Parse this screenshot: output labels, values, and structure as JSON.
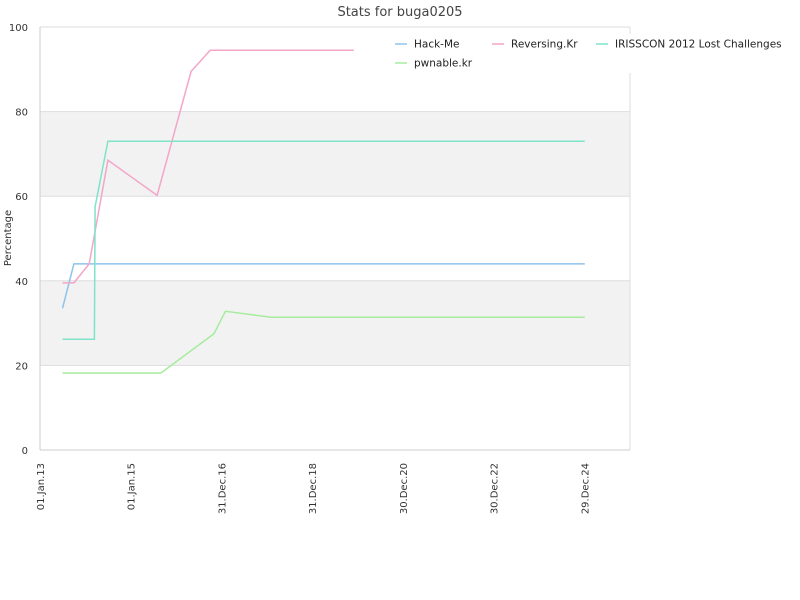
{
  "chart_data": {
    "type": "line",
    "title": "Stats for buga0205",
    "ylabel": "Percentage",
    "xlabel": "",
    "ylim": [
      0,
      100
    ],
    "y_ticks": [
      "0",
      "20",
      "40",
      "60",
      "80",
      "100"
    ],
    "x_ticks": [
      "01.Jan.13",
      "01.Jan.15",
      "31.Dec.16",
      "31.Dec.18",
      "30.Dec.20",
      "30.Dec.22",
      "29.Dec.24"
    ],
    "grid": true,
    "legend_position": "top-right",
    "series": [
      {
        "name": "Hack-Me",
        "color": "#8fc3ea",
        "points": [
          [
            "2013-07-01",
            33.5
          ],
          [
            "2013-10-01",
            44
          ],
          [
            "2025-01-01",
            44
          ]
        ]
      },
      {
        "name": "Reversing.Kr",
        "color": "#f3a6c8",
        "points": [
          [
            "2013-07-01",
            39.5
          ],
          [
            "2013-10-01",
            39.5
          ],
          [
            "2014-02-01",
            44
          ],
          [
            "2014-07-01",
            68.5
          ],
          [
            "2015-08-01",
            60.2
          ],
          [
            "2016-05-01",
            89.5
          ],
          [
            "2016-10-01",
            94.5
          ],
          [
            "2019-12-01",
            94.5
          ]
        ]
      },
      {
        "name": "IRISSCON 2012 Lost Challenges",
        "color": "#7ee3c8",
        "points": [
          [
            "2013-07-01",
            26.2
          ],
          [
            "2014-03-15",
            26.2
          ],
          [
            "2014-03-20",
            57.5
          ],
          [
            "2014-07-01",
            73
          ],
          [
            "2025-01-01",
            73
          ]
        ]
      },
      {
        "name": "pwnable.kr",
        "color": "#a6ec9f",
        "points": [
          [
            "2013-07-01",
            18.2
          ],
          [
            "2015-09-01",
            18.2
          ],
          [
            "2016-11-01",
            27.5
          ],
          [
            "2017-02-01",
            32.8
          ],
          [
            "2018-02-01",
            31.4
          ],
          [
            "2025-01-01",
            31.4
          ]
        ]
      }
    ]
  }
}
